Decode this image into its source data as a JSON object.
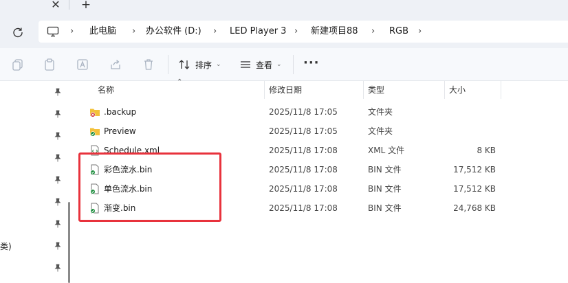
{
  "window": {
    "close_glyph": "✕",
    "new_tab_glyph": "+"
  },
  "address": {
    "crumbs": [
      "此电脑",
      "办公软件 (D:)",
      "LED Player 3",
      "新建项目88",
      "RGB"
    ]
  },
  "toolbar": {
    "sort_label": "排序",
    "view_label": "查看",
    "more_glyph": "···"
  },
  "nav": {
    "partial_text": "类)"
  },
  "columns": {
    "name": "名称",
    "date": "修改日期",
    "type": "类型",
    "size": "大小"
  },
  "files": [
    {
      "name": ".backup",
      "date": "2025/11/8 17:05",
      "type": "文件夹",
      "size": "",
      "icon": "folder-error-icon"
    },
    {
      "name": "Preview",
      "date": "2025/11/8 17:05",
      "type": "文件夹",
      "size": "",
      "icon": "folder-synced-icon"
    },
    {
      "name": "Schedule.xml",
      "date": "2025/11/8 17:08",
      "type": "XML 文件",
      "size": "8 KB",
      "icon": "xml-file-icon"
    },
    {
      "name": "彩色流水.bin",
      "date": "2025/11/8 17:08",
      "type": "BIN 文件",
      "size": "17,512 KB",
      "icon": "bin-file-synced-icon"
    },
    {
      "name": "单色流水.bin",
      "date": "2025/11/8 17:08",
      "type": "BIN 文件",
      "size": "17,512 KB",
      "icon": "bin-file-synced-icon"
    },
    {
      "name": "渐变.bin",
      "date": "2025/11/8 17:08",
      "type": "BIN 文件",
      "size": "24,768 KB",
      "icon": "bin-file-synced-icon"
    }
  ],
  "colors": {
    "highlight": "#e8323c",
    "folder": "#f3c13a",
    "synced": "#1e8e3e",
    "error": "#d13438"
  }
}
